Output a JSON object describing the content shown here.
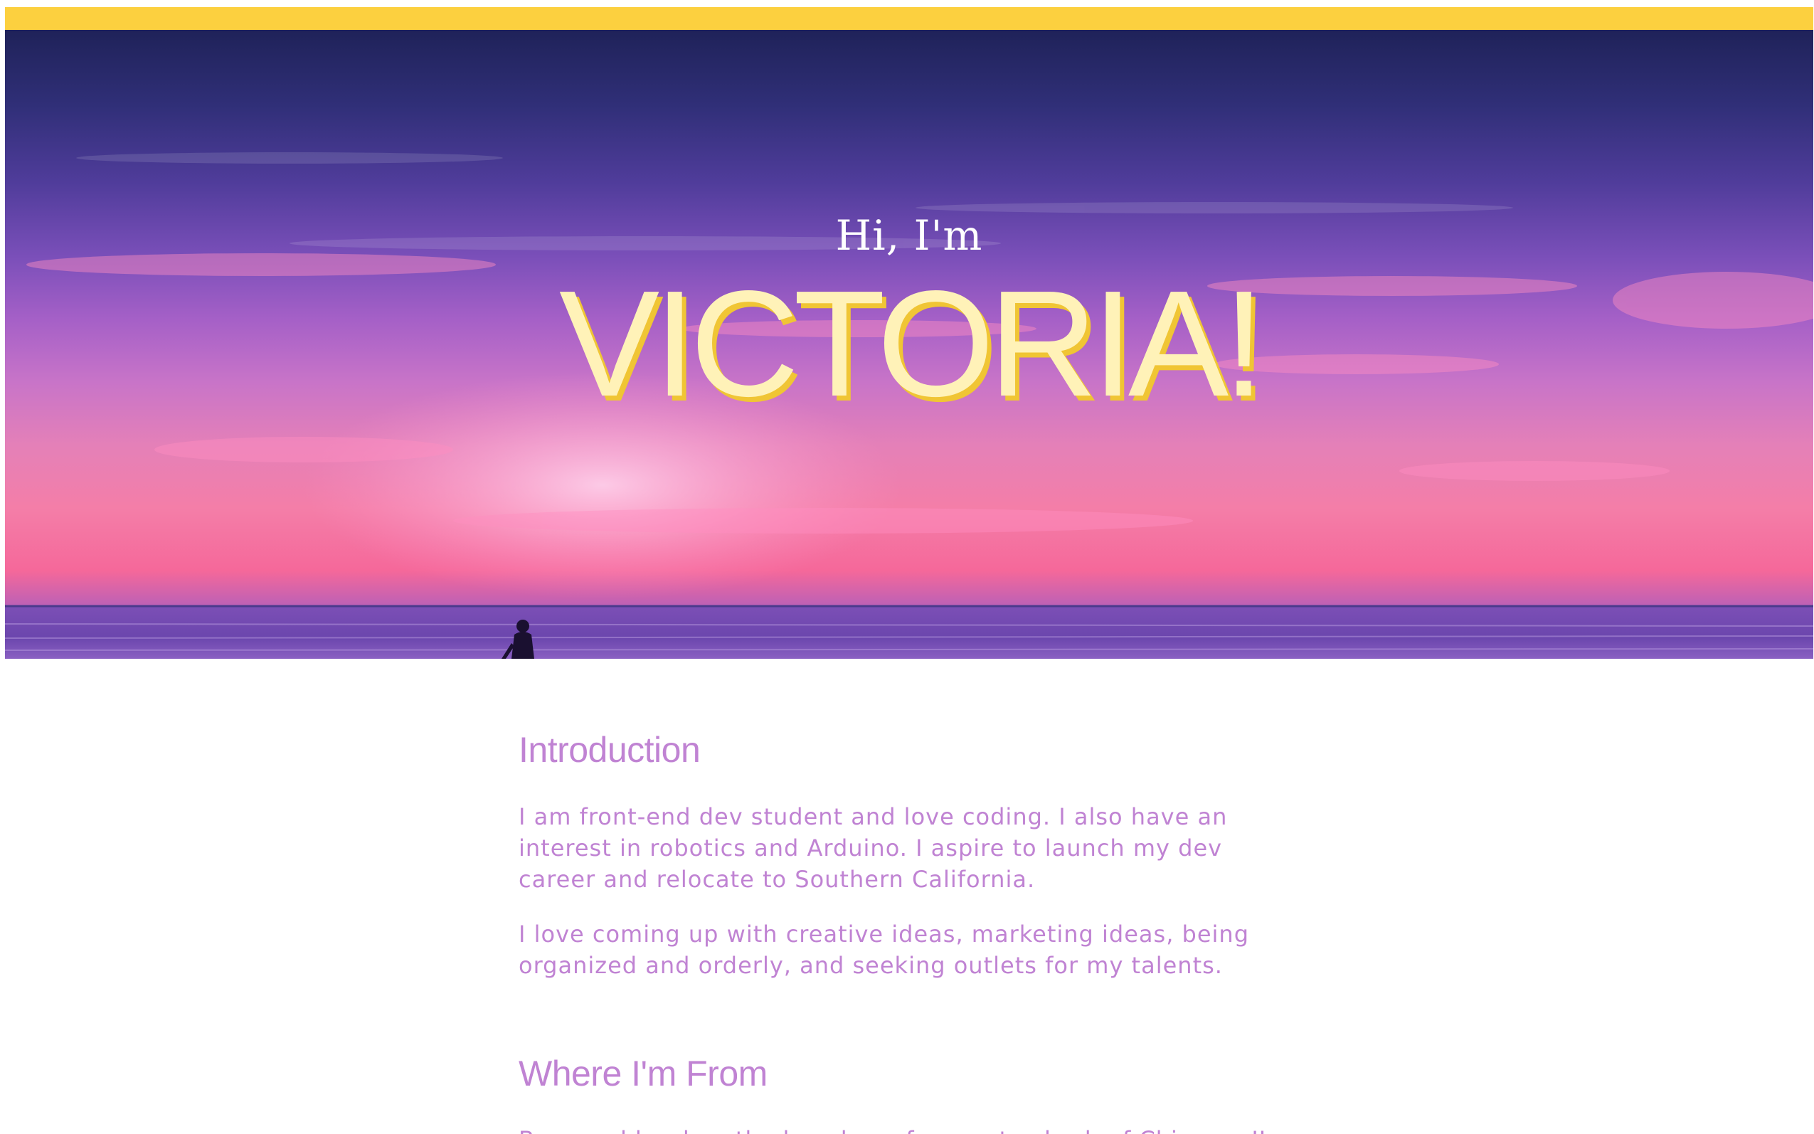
{
  "hero": {
    "greeting": "Hi, I'm",
    "name": "VICTORIA!"
  },
  "introduction": {
    "heading": "Introduction",
    "paragraphs": [
      "I am front-end dev student and love coding. I also have an interest in robotics and Arduino. I aspire to launch my dev career and relocate to Southern California.",
      "I love coming up with creative ideas, marketing ideas, being organized and orderly, and seeking outlets for my talents."
    ]
  },
  "where_from": {
    "heading": "Where I'm From",
    "partial_text": "Born and bred on the beaches of a great suburb of Chicago, IL"
  },
  "colors": {
    "accent_bar": "#fcd03f",
    "heading_text": "#c083d3",
    "hero_name": "#fff2b8",
    "hero_name_shadow": "#f0c534"
  },
  "icons": {
    "hero_image": "sunset-beach-surfer-photo"
  }
}
